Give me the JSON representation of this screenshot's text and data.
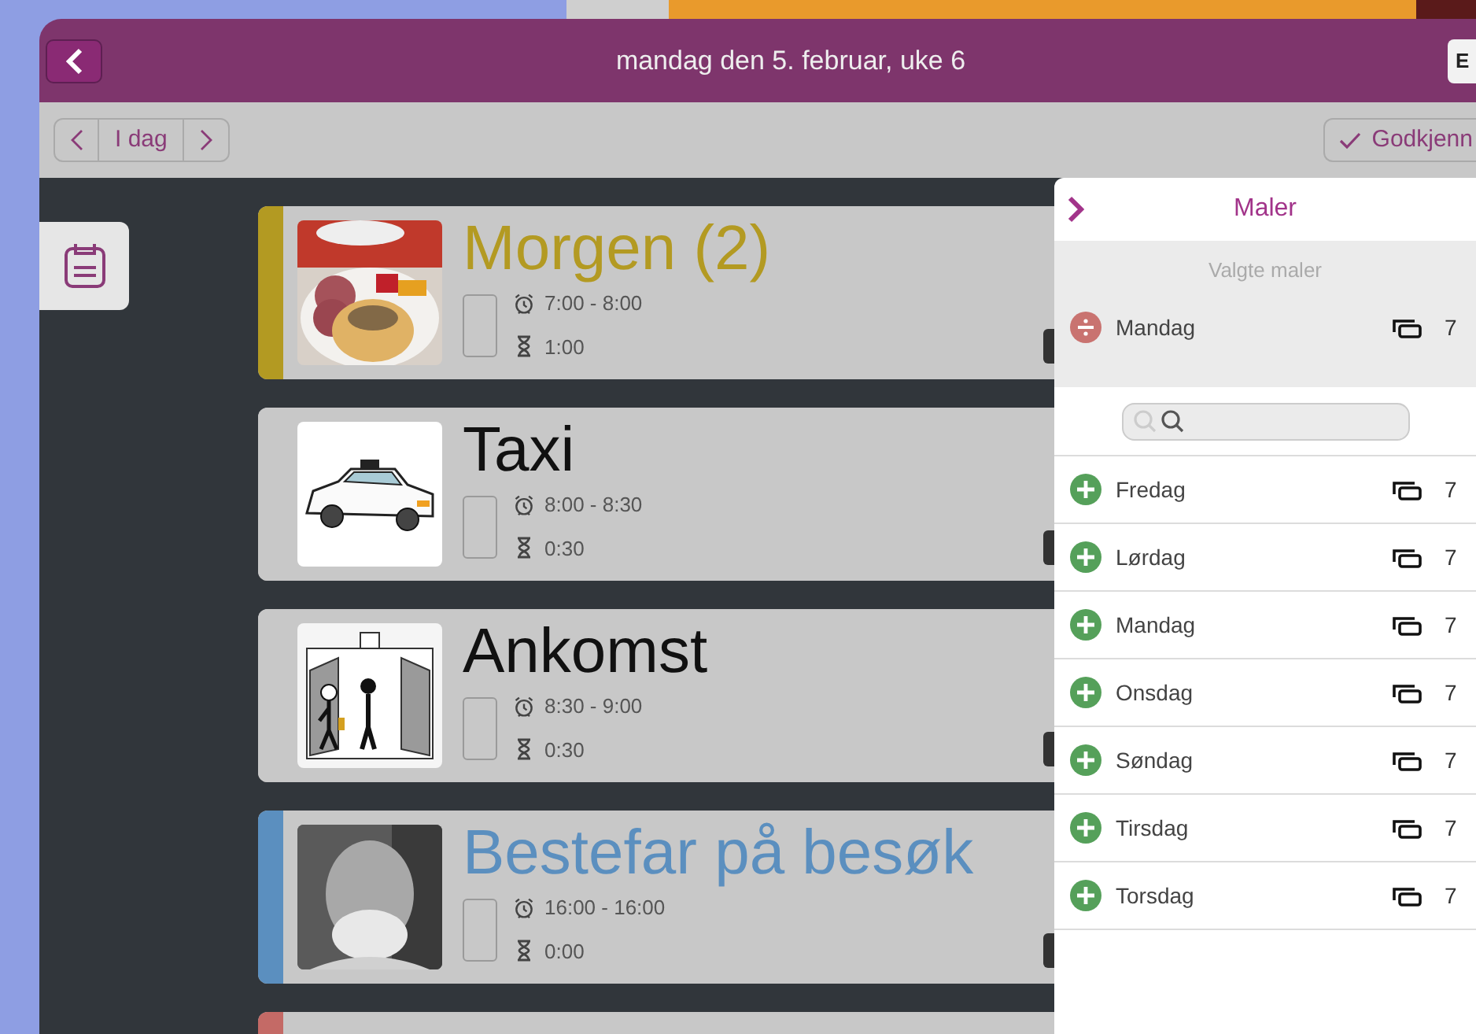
{
  "header": {
    "title": "mandag den 5. februar, uke 6",
    "right_button": "E"
  },
  "toolbar": {
    "today": "I dag",
    "approve": "Godkjenn"
  },
  "activities": [
    {
      "title": "Morgen (2)",
      "time": "7:00 - 8:00",
      "duration": "1:00",
      "color": "#b39a22",
      "checked": false
    },
    {
      "title": "Taxi",
      "time": "8:00 - 8:30",
      "duration": "0:30",
      "checked": false
    },
    {
      "title": "Ankomst",
      "time": "8:30 - 9:00",
      "duration": "0:30",
      "checked": false
    },
    {
      "title": "Bestefar på besøk",
      "time": "16:00 - 16:00",
      "duration": "0:00",
      "color": "#5b8fbf",
      "checked": false
    },
    {
      "color": "#c46a66"
    }
  ],
  "panel": {
    "title": "Maler",
    "selected_heading": "Valgte maler",
    "selected_templates": [
      {
        "name": "Mandag",
        "count": "7"
      }
    ],
    "templates": [
      {
        "name": "Fredag",
        "count": "7"
      },
      {
        "name": "Lørdag",
        "count": "7"
      },
      {
        "name": "Mandag",
        "count": "7"
      },
      {
        "name": "Onsdag",
        "count": "7"
      },
      {
        "name": "Søndag",
        "count": "7"
      },
      {
        "name": "Tirsdag",
        "count": "7"
      },
      {
        "name": "Torsdag",
        "count": "7"
      }
    ]
  }
}
